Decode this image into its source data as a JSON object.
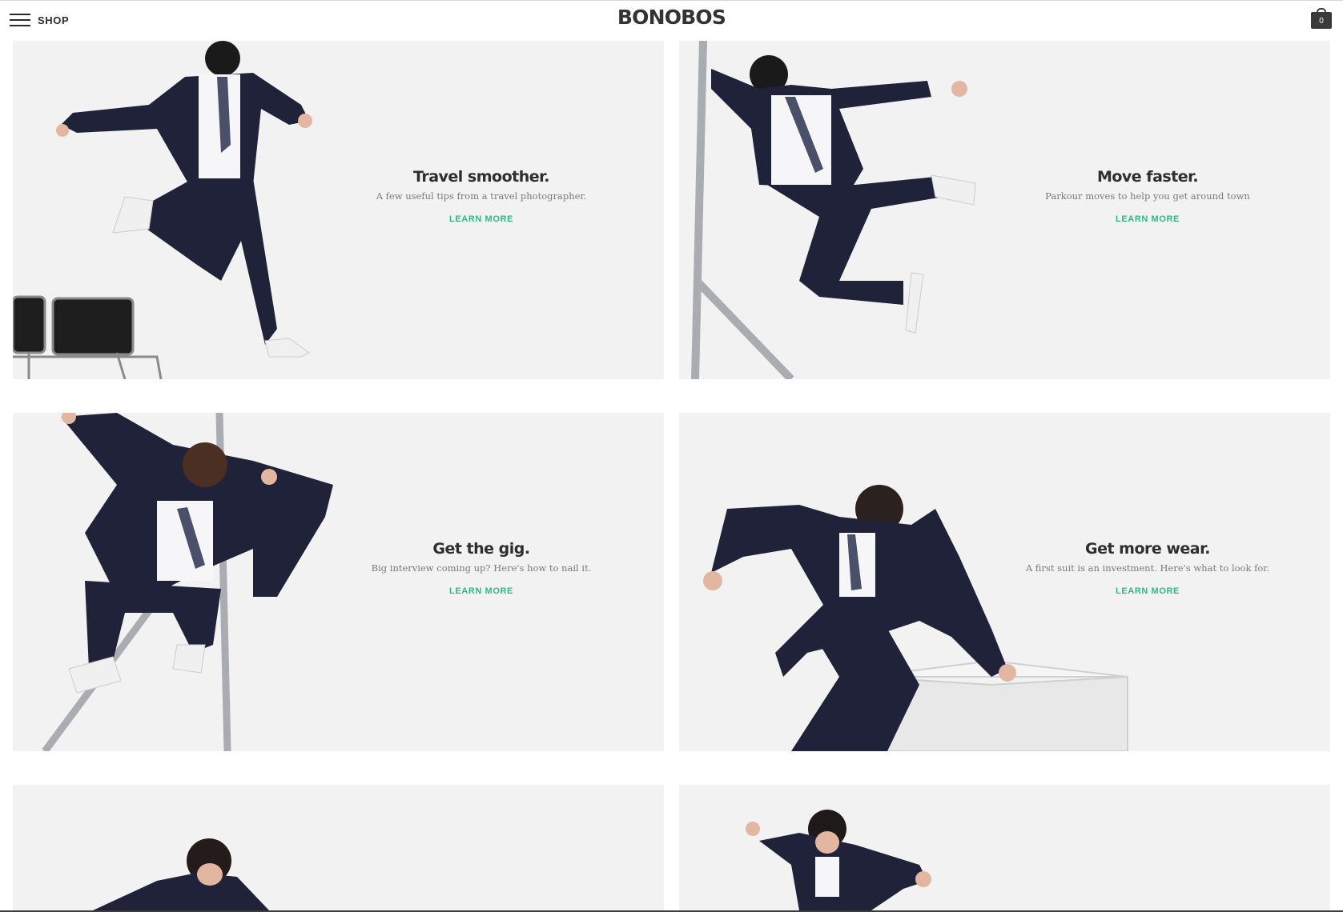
{
  "header": {
    "menu_label": "SHOP",
    "brand": "BONOBOS",
    "cart_count": "0",
    "icons": {
      "menu": "hamburger-icon",
      "cart": "shopping-bag-icon"
    }
  },
  "cards": [
    {
      "title": "Travel smoother.",
      "subtitle": "A few useful tips from a travel photographer.",
      "cta": "LEARN MORE"
    },
    {
      "title": "Move faster.",
      "subtitle": "Parkour moves to help you get around town",
      "cta": "LEARN MORE"
    },
    {
      "title": "Get the gig.",
      "subtitle": "Big interview coming up? Here's how to nail it.",
      "cta": "LEARN MORE"
    },
    {
      "title": "Get more wear.",
      "subtitle": "A first suit is an investment. Here's what to look for.",
      "cta": "LEARN MORE"
    }
  ],
  "colors": {
    "accent": "#2fb886",
    "suit": "#1f2238",
    "card_bg": "#f2f2f2",
    "text": "#2e2e2e"
  }
}
